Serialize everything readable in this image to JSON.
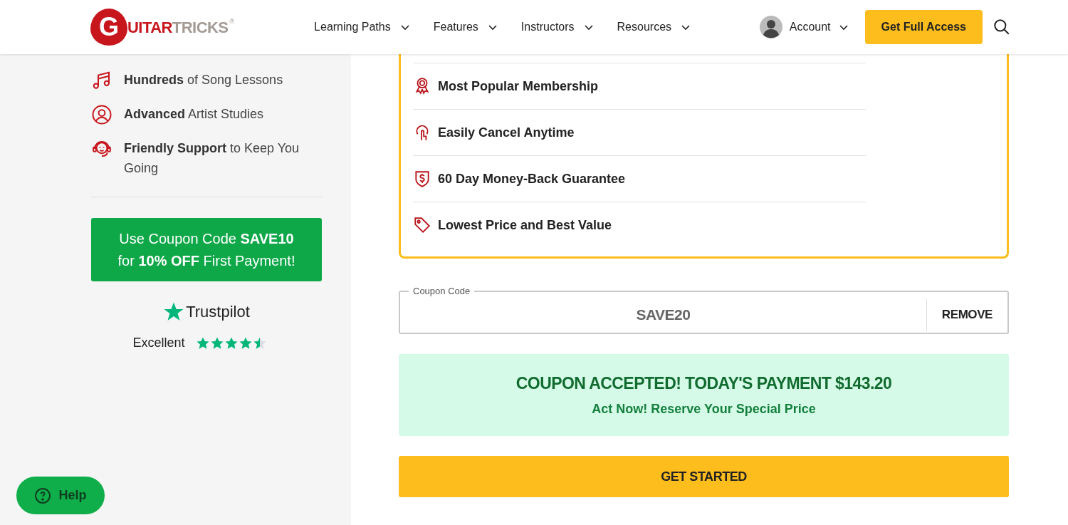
{
  "header": {
    "logo": {
      "initial": "G",
      "red": "UITAR",
      "grey": "TRICKS",
      "mark": "®"
    },
    "nav": [
      {
        "label": "Learning Paths"
      },
      {
        "label": "Features"
      },
      {
        "label": "Instructors"
      },
      {
        "label": "Resources"
      }
    ],
    "account": {
      "label": "Account"
    },
    "cta": "Get Full Access"
  },
  "sidebar": {
    "features": [
      {
        "kind": "music",
        "bold": "Hundreds",
        "rest": "of Song Lessons"
      },
      {
        "kind": "person",
        "bold": "Advanced",
        "rest": "Artist Studies"
      },
      {
        "kind": "support",
        "bold": "Friendly Support",
        "rest": "to Keep You Going"
      }
    ],
    "promo": {
      "line1": "Use Coupon Code **SAVE10**",
      "line2": "for **10% OFF** First Payment!"
    },
    "trustpilot": {
      "brand": "Trustpilot",
      "rating": "Excellent",
      "stars": 4.5
    }
  },
  "benefits": [
    {
      "kind": "award",
      "label": "Most Popular Membership"
    },
    {
      "kind": "pointer",
      "label": "Easily Cancel Anytime"
    },
    {
      "kind": "shield",
      "label": "60 Day Money-Back Guarantee"
    },
    {
      "kind": "tag",
      "label": "Lowest Price and Best Value"
    }
  ],
  "coupon": {
    "label": "Coupon Code",
    "value": "SAVE20",
    "action": "REMOVE"
  },
  "notice": {
    "title": "COUPON ACCEPTED! TODAY'S PAYMENT $143.20",
    "subtitle": "Act Now! Reserve Your Special Price"
  },
  "submit": "GET STARTED",
  "help": "Help"
}
